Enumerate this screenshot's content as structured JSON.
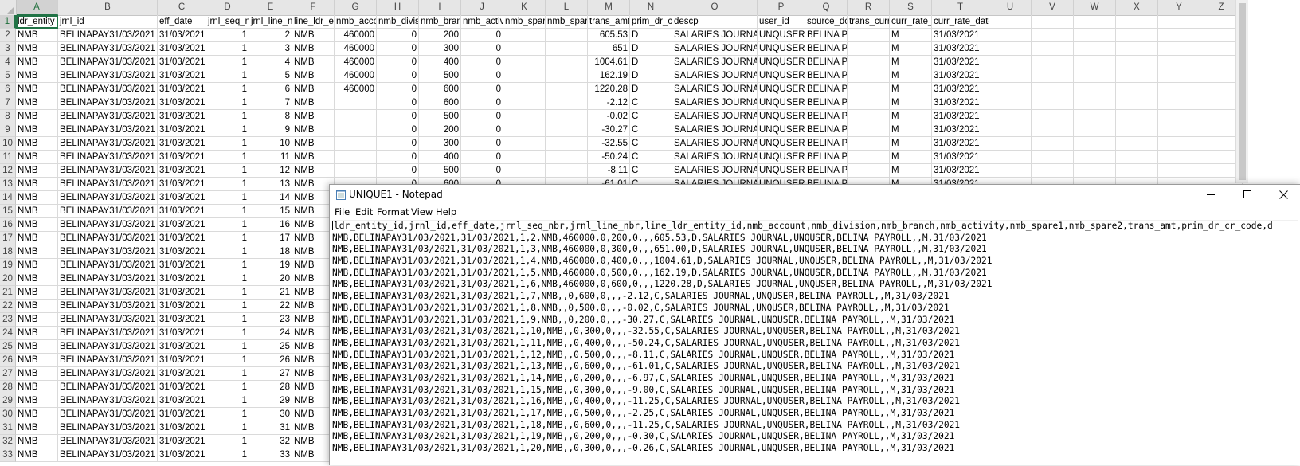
{
  "excel": {
    "columns": [
      {
        "letter": "A",
        "w": 53
      },
      {
        "letter": "B",
        "w": 125
      },
      {
        "letter": "C",
        "w": 61
      },
      {
        "letter": "D",
        "w": 54
      },
      {
        "letter": "E",
        "w": 54
      },
      {
        "letter": "F",
        "w": 53
      },
      {
        "letter": "G",
        "w": 53
      },
      {
        "letter": "H",
        "w": 53
      },
      {
        "letter": "I",
        "w": 53
      },
      {
        "letter": "J",
        "w": 53
      },
      {
        "letter": "K",
        "w": 53
      },
      {
        "letter": "L",
        "w": 53
      },
      {
        "letter": "M",
        "w": 53
      },
      {
        "letter": "N",
        "w": 53
      },
      {
        "letter": "O",
        "w": 107
      },
      {
        "letter": "P",
        "w": 60
      },
      {
        "letter": "Q",
        "w": 53
      },
      {
        "letter": "R",
        "w": 53
      },
      {
        "letter": "S",
        "w": 53
      },
      {
        "letter": "T",
        "w": 72
      },
      {
        "letter": "U",
        "w": 53
      },
      {
        "letter": "V",
        "w": 53
      },
      {
        "letter": "W",
        "w": 53
      },
      {
        "letter": "X",
        "w": 53
      },
      {
        "letter": "Y",
        "w": 53
      },
      {
        "letter": "Z",
        "w": 53
      }
    ],
    "row_numbers": [
      "1",
      "2",
      "3",
      "4",
      "5",
      "6",
      "7",
      "8",
      "9",
      "10",
      "11",
      "12",
      "13",
      "14",
      "15",
      "16",
      "17",
      "18",
      "19",
      "20",
      "21",
      "22",
      "23",
      "24",
      "25",
      "26",
      "27",
      "28",
      "29",
      "30",
      "31",
      "32",
      "33"
    ],
    "header_row": [
      "ldr_entity",
      "jrnl_id",
      "eff_date",
      "jrnl_seq_n",
      "jrnl_line_n",
      "line_ldr_e",
      "nmb_acco",
      "nmb_divis",
      "nmb_bran",
      "nmb_activ",
      "nmb_spar",
      "nmb_spar",
      "trans_amt",
      "prim_dr_c",
      "descp",
      "user_id",
      "source_dc",
      "trans_curr",
      "curr_rate_",
      "curr_rate_date"
    ],
    "rows": [
      [
        "NMB",
        "BELINAPAY31/03/2021",
        "31/03/2021",
        "1",
        "2",
        "NMB",
        "460000",
        "0",
        "200",
        "0",
        "",
        "",
        "605.53",
        "D",
        "SALARIES JOURNAL",
        "UNQUSER",
        "BELINA PAYROLL",
        "",
        "M",
        "31/03/2021"
      ],
      [
        "NMB",
        "BELINAPAY31/03/2021",
        "31/03/2021",
        "1",
        "3",
        "NMB",
        "460000",
        "0",
        "300",
        "0",
        "",
        "",
        "651",
        "D",
        "SALARIES JOURNAL",
        "UNQUSER",
        "BELINA PAYROLL",
        "",
        "M",
        "31/03/2021"
      ],
      [
        "NMB",
        "BELINAPAY31/03/2021",
        "31/03/2021",
        "1",
        "4",
        "NMB",
        "460000",
        "0",
        "400",
        "0",
        "",
        "",
        "1004.61",
        "D",
        "SALARIES JOURNAL",
        "UNQUSER",
        "BELINA PAYROLL",
        "",
        "M",
        "31/03/2021"
      ],
      [
        "NMB",
        "BELINAPAY31/03/2021",
        "31/03/2021",
        "1",
        "5",
        "NMB",
        "460000",
        "0",
        "500",
        "0",
        "",
        "",
        "162.19",
        "D",
        "SALARIES JOURNAL",
        "UNQUSER",
        "BELINA PAYROLL",
        "",
        "M",
        "31/03/2021"
      ],
      [
        "NMB",
        "BELINAPAY31/03/2021",
        "31/03/2021",
        "1",
        "6",
        "NMB",
        "460000",
        "0",
        "600",
        "0",
        "",
        "",
        "1220.28",
        "D",
        "SALARIES JOURNAL",
        "UNQUSER",
        "BELINA PAYROLL",
        "",
        "M",
        "31/03/2021"
      ],
      [
        "NMB",
        "BELINAPAY31/03/2021",
        "31/03/2021",
        "1",
        "7",
        "NMB",
        "",
        "0",
        "600",
        "0",
        "",
        "",
        "-2.12",
        "C",
        "SALARIES JOURNAL",
        "UNQUSER",
        "BELINA PAYROLL",
        "",
        "M",
        "31/03/2021"
      ],
      [
        "NMB",
        "BELINAPAY31/03/2021",
        "31/03/2021",
        "1",
        "8",
        "NMB",
        "",
        "0",
        "500",
        "0",
        "",
        "",
        "-0.02",
        "C",
        "SALARIES JOURNAL",
        "UNQUSER",
        "BELINA PAYROLL",
        "",
        "M",
        "31/03/2021"
      ],
      [
        "NMB",
        "BELINAPAY31/03/2021",
        "31/03/2021",
        "1",
        "9",
        "NMB",
        "",
        "0",
        "200",
        "0",
        "",
        "",
        "-30.27",
        "C",
        "SALARIES JOURNAL",
        "UNQUSER",
        "BELINA PAYROLL",
        "",
        "M",
        "31/03/2021"
      ],
      [
        "NMB",
        "BELINAPAY31/03/2021",
        "31/03/2021",
        "1",
        "10",
        "NMB",
        "",
        "0",
        "300",
        "0",
        "",
        "",
        "-32.55",
        "C",
        "SALARIES JOURNAL",
        "UNQUSER",
        "BELINA PAYROLL",
        "",
        "M",
        "31/03/2021"
      ],
      [
        "NMB",
        "BELINAPAY31/03/2021",
        "31/03/2021",
        "1",
        "11",
        "NMB",
        "",
        "0",
        "400",
        "0",
        "",
        "",
        "-50.24",
        "C",
        "SALARIES JOURNAL",
        "UNQUSER",
        "BELINA PAYROLL",
        "",
        "M",
        "31/03/2021"
      ],
      [
        "NMB",
        "BELINAPAY31/03/2021",
        "31/03/2021",
        "1",
        "12",
        "NMB",
        "",
        "0",
        "500",
        "0",
        "",
        "",
        "-8.11",
        "C",
        "SALARIES JOURNAL",
        "UNQUSER",
        "BELINA PAYROLL",
        "",
        "M",
        "31/03/2021"
      ],
      [
        "NMB",
        "BELINAPAY31/03/2021",
        "31/03/2021",
        "1",
        "13",
        "NMB",
        "",
        "0",
        "600",
        "0",
        "",
        "",
        "-61.01",
        "C",
        "SALARIES JOURNAL",
        "UNQUSER",
        "BELINA PAYROLL",
        "",
        "M",
        "31/03/2021"
      ],
      [
        "NMB",
        "BELINAPAY31/03/2021",
        "31/03/2021",
        "1",
        "14",
        "NMB"
      ],
      [
        "NMB",
        "BELINAPAY31/03/2021",
        "31/03/2021",
        "1",
        "15",
        "NMB"
      ],
      [
        "NMB",
        "BELINAPAY31/03/2021",
        "31/03/2021",
        "1",
        "16",
        "NMB"
      ],
      [
        "NMB",
        "BELINAPAY31/03/2021",
        "31/03/2021",
        "1",
        "17",
        "NMB"
      ],
      [
        "NMB",
        "BELINAPAY31/03/2021",
        "31/03/2021",
        "1",
        "18",
        "NMB"
      ],
      [
        "NMB",
        "BELINAPAY31/03/2021",
        "31/03/2021",
        "1",
        "19",
        "NMB"
      ],
      [
        "NMB",
        "BELINAPAY31/03/2021",
        "31/03/2021",
        "1",
        "20",
        "NMB"
      ],
      [
        "NMB",
        "BELINAPAY31/03/2021",
        "31/03/2021",
        "1",
        "21",
        "NMB"
      ],
      [
        "NMB",
        "BELINAPAY31/03/2021",
        "31/03/2021",
        "1",
        "22",
        "NMB"
      ],
      [
        "NMB",
        "BELINAPAY31/03/2021",
        "31/03/2021",
        "1",
        "23",
        "NMB"
      ],
      [
        "NMB",
        "BELINAPAY31/03/2021",
        "31/03/2021",
        "1",
        "24",
        "NMB"
      ],
      [
        "NMB",
        "BELINAPAY31/03/2021",
        "31/03/2021",
        "1",
        "25",
        "NMB"
      ],
      [
        "NMB",
        "BELINAPAY31/03/2021",
        "31/03/2021",
        "1",
        "26",
        "NMB"
      ],
      [
        "NMB",
        "BELINAPAY31/03/2021",
        "31/03/2021",
        "1",
        "27",
        "NMB"
      ],
      [
        "NMB",
        "BELINAPAY31/03/2021",
        "31/03/2021",
        "1",
        "28",
        "NMB"
      ],
      [
        "NMB",
        "BELINAPAY31/03/2021",
        "31/03/2021",
        "1",
        "29",
        "NMB"
      ],
      [
        "NMB",
        "BELINAPAY31/03/2021",
        "31/03/2021",
        "1",
        "30",
        "NMB"
      ],
      [
        "NMB",
        "BELINAPAY31/03/2021",
        "31/03/2021",
        "1",
        "31",
        "NMB"
      ],
      [
        "NMB",
        "BELINAPAY31/03/2021",
        "31/03/2021",
        "1",
        "32",
        "NMB"
      ],
      [
        "NMB",
        "BELINAPAY31/03/2021",
        "31/03/2021",
        "1",
        "33",
        "NMB"
      ]
    ]
  },
  "notepad": {
    "title": "UNIQUE1 - Notepad",
    "menu": [
      "File",
      "Edit",
      "Format",
      "View",
      "Help"
    ],
    "lines": [
      "ldr_entity_id,jrnl_id,eff_date,jrnl_seq_nbr,jrnl_line_nbr,line_ldr_entity_id,nmb_account,nmb_division,nmb_branch,nmb_activity,nmb_spare1,nmb_spare2,trans_amt,prim_dr_cr_code,d",
      "NMB,BELINAPAY31/03/2021,31/03/2021,1,2,NMB,460000,0,200,0,,,605.53,D,SALARIES JOURNAL,UNQUSER,BELINA PAYROLL,,M,31/03/2021",
      "NMB,BELINAPAY31/03/2021,31/03/2021,1,3,NMB,460000,0,300,0,,,651.00,D,SALARIES JOURNAL,UNQUSER,BELINA PAYROLL,,M,31/03/2021",
      "NMB,BELINAPAY31/03/2021,31/03/2021,1,4,NMB,460000,0,400,0,,,1004.61,D,SALARIES JOURNAL,UNQUSER,BELINA PAYROLL,,M,31/03/2021",
      "NMB,BELINAPAY31/03/2021,31/03/2021,1,5,NMB,460000,0,500,0,,,162.19,D,SALARIES JOURNAL,UNQUSER,BELINA PAYROLL,,M,31/03/2021",
      "NMB,BELINAPAY31/03/2021,31/03/2021,1,6,NMB,460000,0,600,0,,,1220.28,D,SALARIES JOURNAL,UNQUSER,BELINA PAYROLL,,M,31/03/2021",
      "NMB,BELINAPAY31/03/2021,31/03/2021,1,7,NMB,,0,600,0,,,-2.12,C,SALARIES JOURNAL,UNQUSER,BELINA PAYROLL,,M,31/03/2021",
      "NMB,BELINAPAY31/03/2021,31/03/2021,1,8,NMB,,0,500,0,,,-0.02,C,SALARIES JOURNAL,UNQUSER,BELINA PAYROLL,,M,31/03/2021",
      "NMB,BELINAPAY31/03/2021,31/03/2021,1,9,NMB,,0,200,0,,,-30.27,C,SALARIES JOURNAL,UNQUSER,BELINA PAYROLL,,M,31/03/2021",
      "NMB,BELINAPAY31/03/2021,31/03/2021,1,10,NMB,,0,300,0,,,-32.55,C,SALARIES JOURNAL,UNQUSER,BELINA PAYROLL,,M,31/03/2021",
      "NMB,BELINAPAY31/03/2021,31/03/2021,1,11,NMB,,0,400,0,,,-50.24,C,SALARIES JOURNAL,UNQUSER,BELINA PAYROLL,,M,31/03/2021",
      "NMB,BELINAPAY31/03/2021,31/03/2021,1,12,NMB,,0,500,0,,,-8.11,C,SALARIES JOURNAL,UNQUSER,BELINA PAYROLL,,M,31/03/2021",
      "NMB,BELINAPAY31/03/2021,31/03/2021,1,13,NMB,,0,600,0,,,-61.01,C,SALARIES JOURNAL,UNQUSER,BELINA PAYROLL,,M,31/03/2021",
      "NMB,BELINAPAY31/03/2021,31/03/2021,1,14,NMB,,0,200,0,,,-6.97,C,SALARIES JOURNAL,UNQUSER,BELINA PAYROLL,,M,31/03/2021",
      "NMB,BELINAPAY31/03/2021,31/03/2021,1,15,NMB,,0,300,0,,,-9.00,C,SALARIES JOURNAL,UNQUSER,BELINA PAYROLL,,M,31/03/2021",
      "NMB,BELINAPAY31/03/2021,31/03/2021,1,16,NMB,,0,400,0,,,-11.25,C,SALARIES JOURNAL,UNQUSER,BELINA PAYROLL,,M,31/03/2021",
      "NMB,BELINAPAY31/03/2021,31/03/2021,1,17,NMB,,0,500,0,,,-2.25,C,SALARIES JOURNAL,UNQUSER,BELINA PAYROLL,,M,31/03/2021",
      "NMB,BELINAPAY31/03/2021,31/03/2021,1,18,NMB,,0,600,0,,,-11.25,C,SALARIES JOURNAL,UNQUSER,BELINA PAYROLL,,M,31/03/2021",
      "NMB,BELINAPAY31/03/2021,31/03/2021,1,19,NMB,,0,200,0,,,-0.30,C,SALARIES JOURNAL,UNQUSER,BELINA PAYROLL,,M,31/03/2021",
      "NMB,BELINAPAY31/03/2021,31/03/2021,1,20,NMB,,0,300,0,,,-0.26,C,SALARIES JOURNAL,UNQUSER,BELINA PAYROLL,,M,31/03/2021"
    ]
  },
  "colors": {
    "excel_green": "#217346",
    "header_bg": "#e6e6e6",
    "gridline": "#dadada"
  }
}
